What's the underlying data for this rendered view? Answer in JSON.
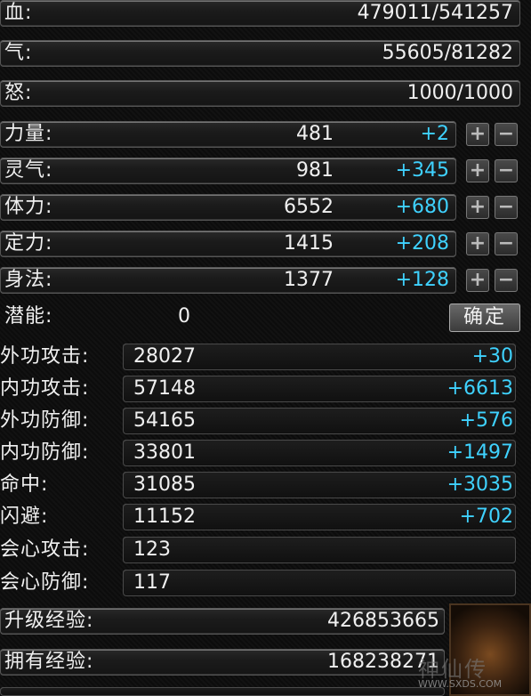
{
  "vitals": [
    {
      "label": "血:",
      "value": "479011/541257"
    },
    {
      "label": "气:",
      "value": "55605/81282"
    },
    {
      "label": "怒:",
      "value": "1000/1000"
    }
  ],
  "attributes": [
    {
      "label": "力量:",
      "value": "481",
      "bonus": "+2"
    },
    {
      "label": "灵气:",
      "value": "981",
      "bonus": "+345"
    },
    {
      "label": "体力:",
      "value": "6552",
      "bonus": "+680"
    },
    {
      "label": "定力:",
      "value": "1415",
      "bonus": "+208"
    },
    {
      "label": "身法:",
      "value": "1377",
      "bonus": "+128"
    }
  ],
  "potential": {
    "label": "潜能:",
    "value": "0",
    "confirm_label": "确定"
  },
  "combat": [
    {
      "label": "外功攻击:",
      "value": "28027",
      "bonus": "+30"
    },
    {
      "label": "内功攻击:",
      "value": "57148",
      "bonus": "+6613"
    },
    {
      "label": "外功防御:",
      "value": "54165",
      "bonus": "+576"
    },
    {
      "label": "内功防御:",
      "value": "33801",
      "bonus": "+1497"
    },
    {
      "label": "命中:",
      "value": "31085",
      "bonus": "+3035"
    },
    {
      "label": "闪避:",
      "value": "11152",
      "bonus": "+702"
    },
    {
      "label": "会心攻击:",
      "value": "123",
      "bonus": ""
    },
    {
      "label": "会心防御:",
      "value": "117",
      "bonus": ""
    }
  ],
  "experience": [
    {
      "label": "升级经验:",
      "value": "426853665"
    },
    {
      "label": "拥有经验:",
      "value": "168238271"
    }
  ],
  "watermark": {
    "logo": "神仙传",
    "site": "WWW.SXDS.COM"
  },
  "icons": {
    "plus": "plus-icon",
    "minus": "minus-icon",
    "emblem": "dragon-emblem-icon"
  },
  "colors": {
    "bonus": "#3fd2ff",
    "text": "#f0f0f0"
  }
}
